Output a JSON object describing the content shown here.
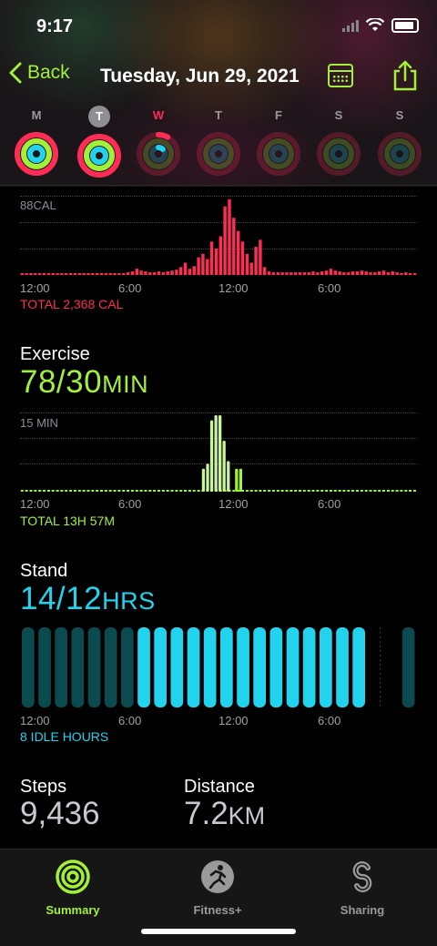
{
  "status": {
    "time": "9:17"
  },
  "nav": {
    "back_label": "Back",
    "title": "Tuesday, Jun 29, 2021"
  },
  "week": [
    {
      "label": "M",
      "state": "past",
      "move": 1.05,
      "exercise": 1.0,
      "stand": 1.0
    },
    {
      "label": "T",
      "state": "today",
      "move": 1.05,
      "exercise": 1.0,
      "stand": 1.0
    },
    {
      "label": "W",
      "state": "current",
      "move": 0.08,
      "exercise": 0.0,
      "stand": 0.12
    },
    {
      "label": "T",
      "state": "future",
      "move": 0,
      "exercise": 0,
      "stand": 0
    },
    {
      "label": "F",
      "state": "future",
      "move": 0,
      "exercise": 0,
      "stand": 0
    },
    {
      "label": "S",
      "state": "future",
      "move": 0,
      "exercise": 0,
      "stand": 0
    },
    {
      "label": "S",
      "state": "future",
      "move": 0,
      "exercise": 0,
      "stand": 0
    }
  ],
  "colors": {
    "move": "#ff2d55",
    "exercise": "#a3f03b",
    "stand": "#22d3ee",
    "accent": "#a3f03b"
  },
  "move": {
    "ymax_label": "88CAL",
    "total": "TOTAL 2,368 CAL",
    "x_ticks": [
      "12:00",
      "6:00",
      "12:00",
      "6:00"
    ]
  },
  "exercise": {
    "title": "Exercise",
    "value": "78/30",
    "unit": "MIN",
    "ymax_label": "15 MIN",
    "total": "TOTAL 13H 57M",
    "x_ticks": [
      "12:00",
      "6:00",
      "12:00",
      "6:00"
    ]
  },
  "stand": {
    "title": "Stand",
    "value": "14/12",
    "unit": "HRS",
    "idle": "8 IDLE HOURS",
    "x_ticks": [
      "12:00",
      "6:00",
      "12:00",
      "6:00"
    ]
  },
  "stats": {
    "steps_label": "Steps",
    "steps_value": "9,436",
    "distance_label": "Distance",
    "distance_value": "7.2",
    "distance_unit": "KM"
  },
  "tabs": [
    {
      "label": "Summary",
      "active": true
    },
    {
      "label": "Fitness+",
      "active": false
    },
    {
      "label": "Sharing",
      "active": false
    }
  ],
  "chart_data": [
    {
      "type": "bar",
      "title": "",
      "ylabel": "CAL",
      "ylim": [
        0,
        88
      ],
      "x": [
        0,
        0.33,
        0.67,
        1,
        1.33,
        1.67,
        2,
        2.33,
        2.67,
        3,
        3.33,
        3.67,
        4,
        4.33,
        4.67,
        5,
        5.33,
        5.67,
        6,
        6.33,
        6.67,
        7,
        7.33,
        7.67,
        8,
        8.33,
        8.67,
        9,
        9.33,
        9.67,
        10,
        10.33,
        10.67,
        11,
        11.33,
        11.67,
        12,
        12.33,
        12.67,
        13,
        13.33,
        13.67,
        14,
        14.33,
        14.67,
        15,
        15.33,
        15.67,
        16,
        16.33,
        16.67,
        17,
        17.33,
        17.67,
        18,
        18.33,
        18.67,
        19,
        19.33,
        19.67,
        20,
        20.33,
        20.67,
        21,
        21.33,
        21.67,
        22,
        22.33,
        22.67,
        23,
        23.33
      ],
      "values": [
        2,
        2,
        2,
        2,
        2,
        2,
        2,
        2,
        2,
        2,
        2,
        2,
        2,
        2,
        2,
        2,
        2,
        2,
        2,
        2,
        2,
        2,
        2,
        2,
        3,
        4,
        7,
        5,
        4,
        3,
        3,
        4,
        3,
        4,
        5,
        6,
        9,
        14,
        7,
        10,
        20,
        24,
        18,
        38,
        30,
        44,
        78,
        86,
        65,
        50,
        38,
        24,
        14,
        32,
        40,
        9,
        4,
        3,
        3,
        3,
        3,
        3,
        3,
        3,
        3,
        3,
        4,
        3,
        4,
        5,
        7,
        5,
        4,
        3,
        3,
        4,
        4,
        5,
        4,
        3,
        3,
        4,
        5,
        3,
        4,
        3,
        2,
        3,
        2,
        2
      ]
    },
    {
      "type": "bar",
      "title": "",
      "ylabel": "MIN",
      "ylim": [
        0,
        15
      ],
      "values": [
        0.3,
        0.3,
        0.3,
        0.3,
        0.3,
        0.3,
        0.3,
        0.3,
        0.3,
        0.3,
        0.3,
        0.3,
        0.3,
        0.3,
        0.3,
        0.3,
        0.3,
        0.3,
        0.3,
        0.3,
        0.3,
        0.3,
        0.3,
        0.3,
        0.3,
        0.3,
        0.3,
        0.3,
        0.3,
        0.3,
        0.3,
        0.3,
        0.3,
        0.3,
        0.3,
        0.3,
        0.3,
        0.3,
        0.3,
        0.3,
        0.3,
        0.3,
        0.3,
        0.3,
        0.3,
        0.3,
        0.3,
        0.3,
        0.3,
        0.3,
        0.3,
        0.3,
        0.3,
        0.3,
        0.3,
        0.3,
        0.3,
        0.3,
        0.3,
        0.3,
        0.3,
        0.3,
        0.3,
        0.3,
        0.3,
        0.3,
        0.3,
        0.3,
        0.3,
        0.3,
        0.3,
        0.3,
        0.3,
        0.3,
        0.3,
        0.3,
        0.3,
        0.3,
        0.3,
        0.3,
        0.3,
        0.3,
        0.3,
        0.3,
        0.3,
        0.3,
        0.3,
        0.3,
        0.3,
        0.3
      ],
      "highlights": [
        {
          "hour": 11.0,
          "value": 4.5,
          "color": "#c8f59a"
        },
        {
          "hour": 11.25,
          "value": 5.5,
          "color": "#c8f59a"
        },
        {
          "hour": 11.5,
          "value": 14,
          "color": "#c8f59a"
        },
        {
          "hour": 11.75,
          "value": 15,
          "color": "#c8f59a"
        },
        {
          "hour": 12.0,
          "value": 15,
          "color": "#c8f59a"
        },
        {
          "hour": 12.25,
          "value": 10,
          "color": "#c8f59a"
        },
        {
          "hour": 12.5,
          "value": 6,
          "color": "#c8f59a"
        },
        {
          "hour": 13.0,
          "value": 4.5,
          "color": "#a3f03b"
        },
        {
          "hour": 13.25,
          "value": 4.5,
          "color": "#a3f03b"
        }
      ]
    },
    {
      "type": "bar",
      "title": "",
      "ylabel": "HRS",
      "categories": [
        "0",
        "1",
        "2",
        "3",
        "4",
        "5",
        "6",
        "7",
        "8",
        "9",
        "10",
        "11",
        "12",
        "13",
        "14",
        "15",
        "16",
        "17",
        "18",
        "19",
        "20",
        "21",
        "22",
        "23"
      ],
      "values": [
        0,
        0,
        0,
        0,
        0,
        0,
        0,
        1,
        1,
        1,
        1,
        1,
        1,
        1,
        1,
        1,
        1,
        1,
        1,
        1,
        1,
        null,
        null,
        0
      ],
      "legend": "stand hour achieved = 1, idle = 0"
    }
  ]
}
